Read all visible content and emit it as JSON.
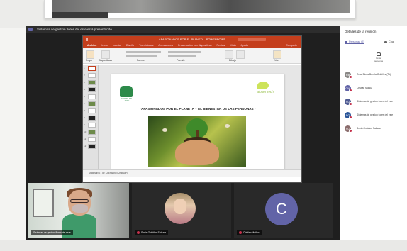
{
  "window": {
    "sharing_title": "Sistemas de gestion flores del este está presentando"
  },
  "powerpoint": {
    "title_bar": "APASIONADOS POR EL PLANETA - POWERPOINT",
    "tabs": [
      "Archivo",
      "Inicio",
      "Insertar",
      "Diseño",
      "Transiciones",
      "Animaciones",
      "Presentación con diapositivas",
      "Revisar",
      "Vista",
      "Ayuda"
    ],
    "share_button": "Compartir",
    "ribbon_labels": [
      "Pegar",
      "Diapositivas",
      "Fuente",
      "Párrafo",
      "Dibujo",
      "Voz"
    ],
    "slide": {
      "title": "\"APASIONADOS POR EL PLANETA Y EL BIENESTAR DE LAS PERSONAS \"",
      "logo_left_text": "FLORES DEL ESTE",
      "logo_right_text": "Bloom Tech"
    },
    "status_bar": "Diapositiva 1 de 12    Español (Uruguay)"
  },
  "panel": {
    "title": "Detalles de la reunión",
    "tab_people": "Personas (5)",
    "tab_chat": "Chat",
    "invite_label": "Invitar personas",
    "participants": [
      {
        "initials": "RB",
        "name": "Rosa Elena Bonilla Ordóñez (Tú)",
        "color": "#8a8886"
      },
      {
        "initials": "CM",
        "name": "Cristian Muñoz",
        "color": "#6264a7"
      },
      {
        "initials": "SG",
        "name": "Sistemas de gestion flores del este",
        "color": "#4f5b93"
      },
      {
        "initials": "SG",
        "name": "Sistemas de gestion flores del este",
        "color": "#2b579a"
      },
      {
        "initials": "SO",
        "name": "Sonia Ordóñez Salazar",
        "color": "#8b6d6d"
      }
    ]
  },
  "tiles": {
    "camera_name": "Sistemas de gestion flores del este",
    "tile_a_name": "Sonia Ordóñez Salazar",
    "tile_b_name": "Cristian Muñoz",
    "tile_b_letter": "C"
  },
  "colors": {
    "teams_purple": "#6264a7",
    "ppt_red": "#c43e1c"
  }
}
